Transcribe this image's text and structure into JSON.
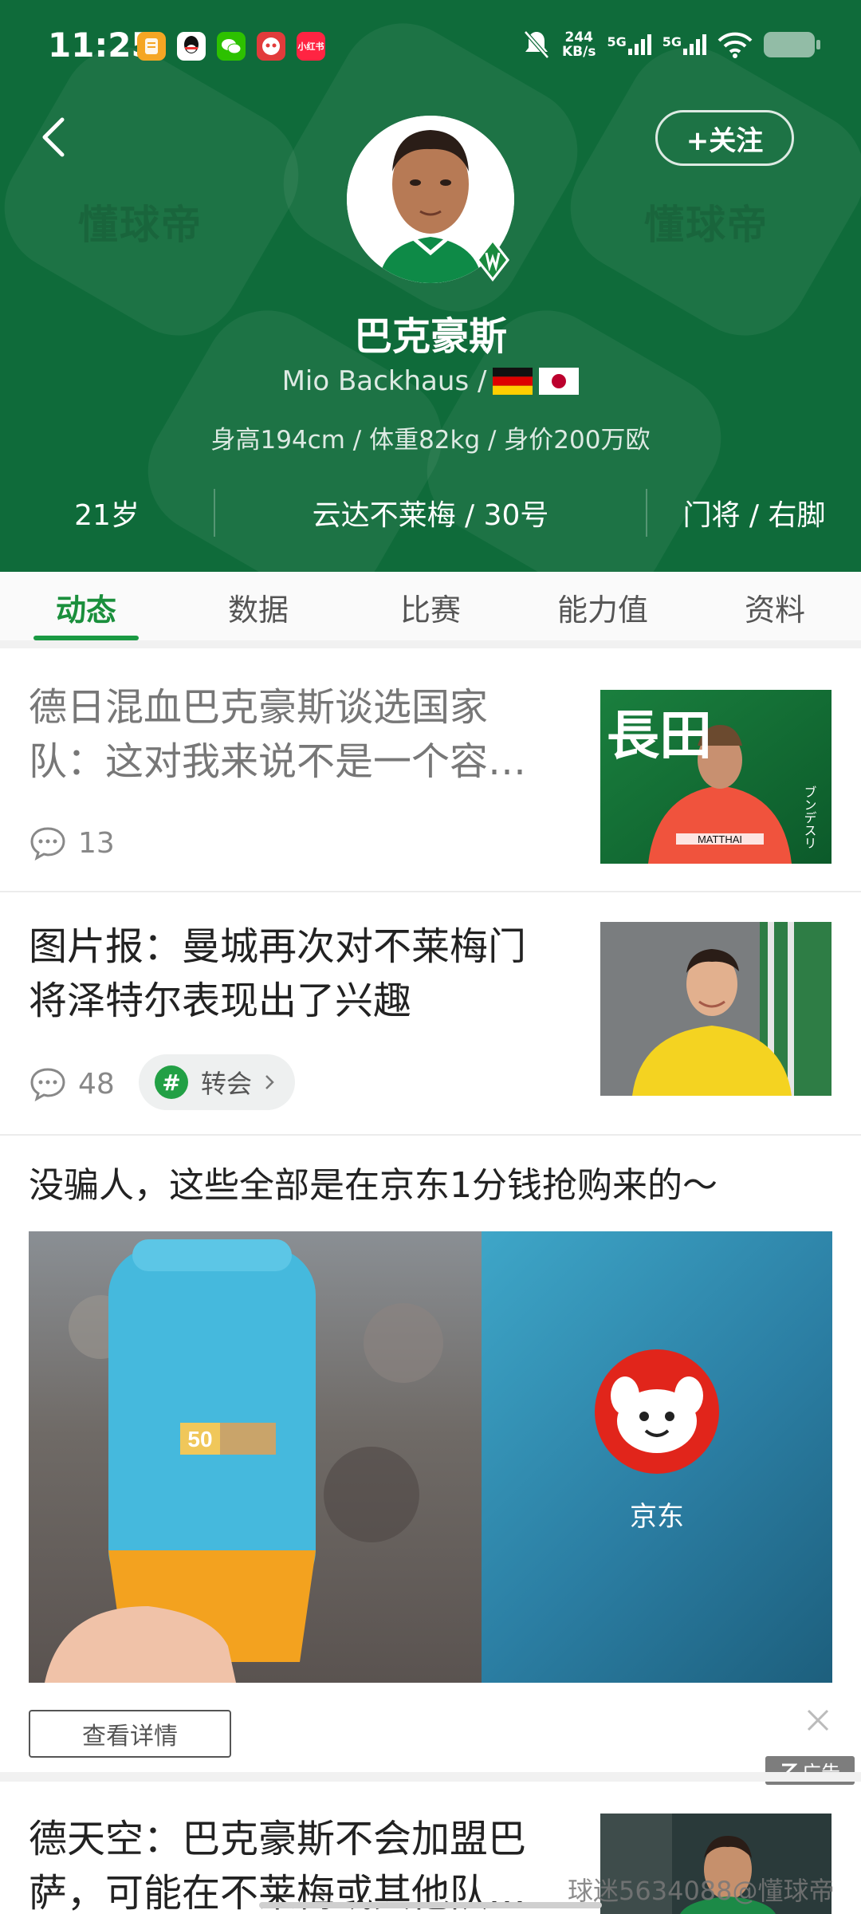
{
  "status_bar": {
    "time": "11:25",
    "net_speed_value": "244",
    "net_speed_unit": "KB/s",
    "signal_1": "5G",
    "signal_2": "5G",
    "app_icons": [
      "notes-icon",
      "qq-icon",
      "wechat-icon",
      "app-icon",
      "xiaohongshu-icon"
    ],
    "xiaohongshu_label": "小红书"
  },
  "header": {
    "follow_label": "+关注",
    "watermark_text": "懂球帝",
    "player_name": "巴克豪斯",
    "player_en_name": "Mio Backhaus /",
    "flags": [
      "germany-flag-icon",
      "japan-flag-icon"
    ],
    "player_stats": "身高194cm / 体重82kg / 身价200万欧",
    "age": "21岁",
    "club_number": "云达不莱梅 / 30号",
    "position_foot": "门将 / 右脚",
    "accent_color": "#0f6b3a"
  },
  "tabs": [
    {
      "label": "动态",
      "active": true
    },
    {
      "label": "数据",
      "active": false
    },
    {
      "label": "比赛",
      "active": false
    },
    {
      "label": "能力值",
      "active": false
    },
    {
      "label": "资料",
      "active": false
    }
  ],
  "feed": {
    "item1": {
      "title": "德日混血巴克豪斯谈选国家队：这对我来说不是一个容易的决定",
      "comments": "13",
      "thumb_text": "長田",
      "thumb_side_text": "ブンデスリ",
      "thumb_sponsor": "MATTHAI"
    },
    "item2": {
      "title": "图片报：曼城再次对不莱梅门将泽特尔表现出了兴趣",
      "comments": "48",
      "tag": "转会"
    },
    "ad": {
      "title": "没骗人，这些全部是在京东1分钱抢购来的～",
      "brand": "京东",
      "product_spf": "50",
      "detail_button": "查看详情",
      "ad_badge": "广告"
    },
    "item3": {
      "title": "德天空：巴克豪斯不会加盟巴萨，可能在不莱梅或其他队出场"
    }
  },
  "footer_watermark": "球迷5634088@懂球帝"
}
